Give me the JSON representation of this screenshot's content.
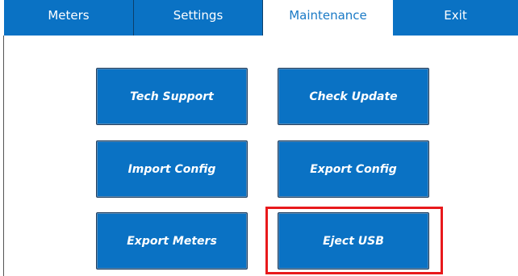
{
  "tabs": [
    {
      "label": "Meters",
      "active": false
    },
    {
      "label": "Settings",
      "active": false
    },
    {
      "label": "Maintenance",
      "active": true
    },
    {
      "label": "Exit",
      "active": false
    }
  ],
  "buttons": {
    "tech_support": "Tech Support",
    "check_update": "Check Update",
    "import_config": "Import Config",
    "export_config": "Export Config",
    "export_meters": "Export Meters",
    "eject_usb": "Eject USB"
  },
  "colors": {
    "accent": "#0a72c4",
    "highlight": "#e8191c"
  }
}
